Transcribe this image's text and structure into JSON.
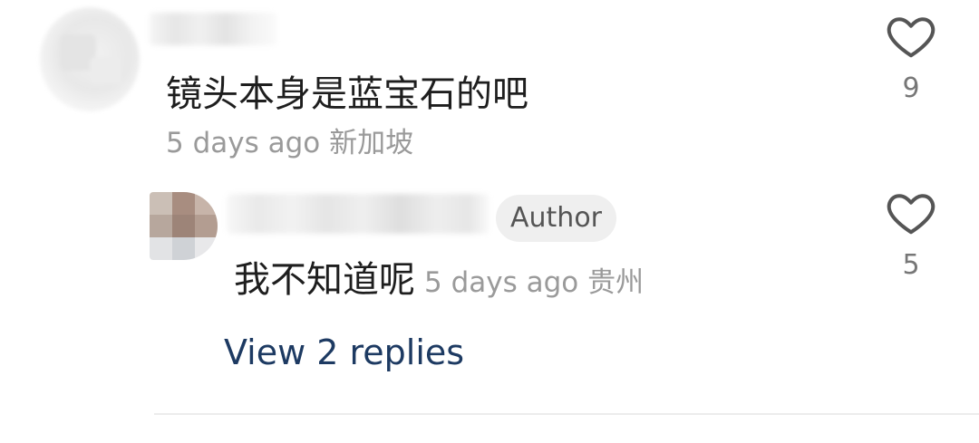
{
  "comment": {
    "text": "镜头本身是蓝宝石的吧",
    "meta": "5 days ago 新加坡",
    "like_count": "9",
    "like_icon": "heart-outline-icon"
  },
  "reply": {
    "badge": "Author",
    "text": "我不知道呢",
    "meta": "5 days ago 贵州",
    "like_count": "5",
    "like_icon": "heart-outline-icon"
  },
  "view_replies_label": "View 2 replies",
  "colors": {
    "link": "#1d3a62",
    "meta": "#9a9a9a",
    "badge_bg": "#efefef",
    "icon": "#555555"
  }
}
